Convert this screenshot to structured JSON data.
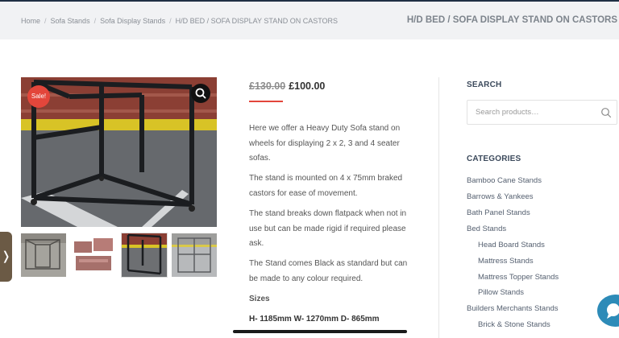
{
  "breadcrumb": {
    "home": "Home",
    "level1": "Sofa Stands",
    "level2": "Sofa Display Stands",
    "current": "H/D BED / SOFA DISPLAY STAND ON CASTORS",
    "separator": "/"
  },
  "page_title": "H/D BED / SOFA DISPLAY STAND ON CASTORS",
  "product": {
    "sale_badge": "Sale!",
    "old_price": "£130.00",
    "new_price": "£100.00",
    "description": [
      "Here we offer a Heavy Duty Sofa stand on wheels for displaying 2 x 2, 3 and 4 seater sofas.",
      "The stand is mounted on 4 x 75mm braked castors for ease of movement.",
      "The stand breaks down flatpack when not in use but can be made rigid if required please ask.",
      "The Stand comes Black as standard but can be made to any colour required."
    ],
    "sizes_label": "Sizes",
    "dimensions": "H- 1185mm W- 1270mm D- 865mm"
  },
  "side_tab_glyph": "❭",
  "sidebar": {
    "search_title": "SEARCH",
    "search_placeholder": "Search products…",
    "categories_title": "CATEGORIES",
    "categories": [
      "Bamboo Cane Stands",
      "Barrows & Yankees",
      "Bath Panel Stands",
      "Bed Stands",
      "Head Board Stands",
      "Mattress Stands",
      "Mattress Topper Stands",
      "Pillow Stands",
      "Builders Merchants Stands",
      "Brick & Stone Stands"
    ]
  },
  "colors": {
    "sale_red": "#e3463b",
    "header_bar": "#f1f2f4",
    "chat_blue": "#2d8bb8"
  },
  "icons": [
    "zoom-icon",
    "search-icon",
    "chevron-right-icon",
    "chat-icon"
  ]
}
